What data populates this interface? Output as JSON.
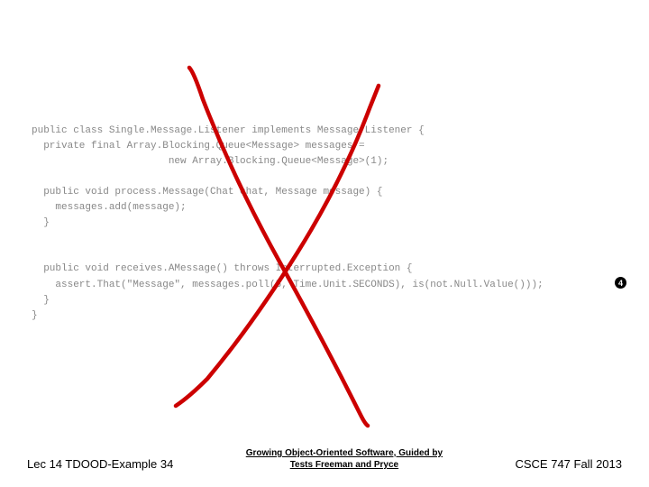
{
  "code": {
    "line1": "public class Single.Message.Listener implements Message.Listener {",
    "line2": "  private final Array.Blocking.Queue<Message> messages =",
    "line3": "                       new Array.Blocking.Queue<Message>(1);",
    "line4": "",
    "line5": "  public void process.Message(Chat chat, Message message) {",
    "line6": "    messages.add(message);",
    "line7": "  }",
    "line8": "",
    "line9": "",
    "line10": "  public void receives.AMessage() throws Interrupted.Exception {",
    "line11": "    assert.That(\"Message\", messages.poll(5, Time.Unit.SECONDS), is(not.Null.Value()));",
    "line12": "  }",
    "line13": "}"
  },
  "annotation": {
    "marker": "4"
  },
  "footer": {
    "left": "Lec 14 TDOOD-Example 34",
    "center_line1": "Growing Object-Oriented Software, Guided by",
    "center_line2": "Tests Freeman and Pryce",
    "right": "CSCE 747 Fall 2013"
  }
}
